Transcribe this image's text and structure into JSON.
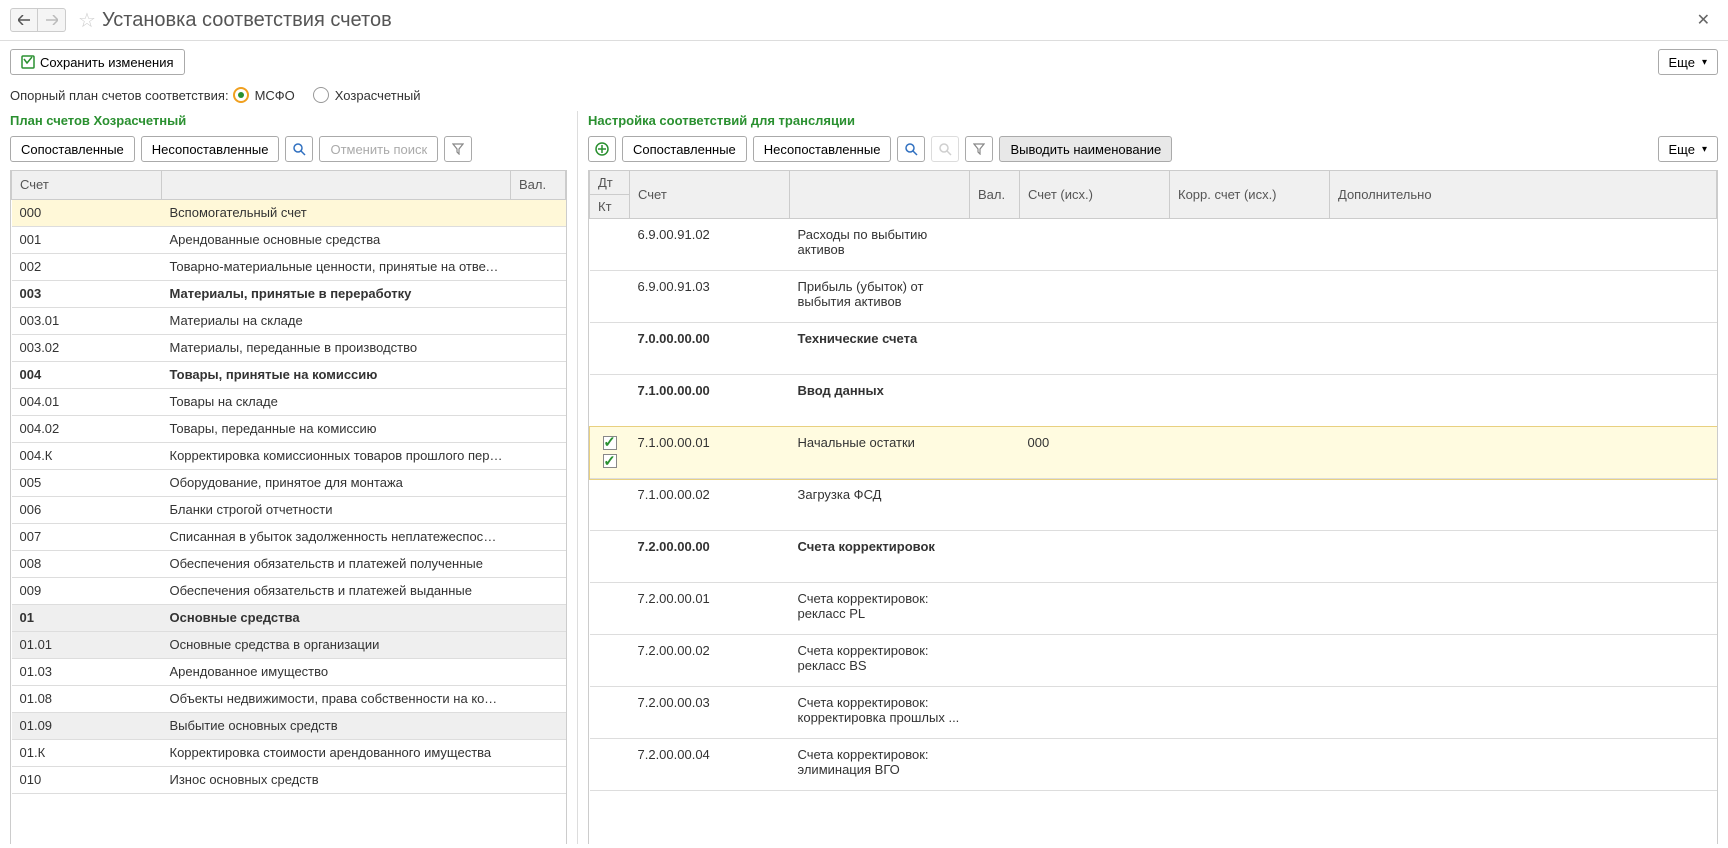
{
  "header": {
    "title": "Установка соответствия счетов"
  },
  "toolbar": {
    "save_label": "Сохранить изменения",
    "more_label": "Еще"
  },
  "radio": {
    "prefix": "Опорный план счетов соответствия:",
    "opt1": "МСФО",
    "opt2": "Хозрасчетный"
  },
  "left": {
    "title": "План счетов Хозрасчетный",
    "btn_matched": "Сопоставленные",
    "btn_unmatched": "Несопоставленные",
    "btn_cancel_search": "Отменить поиск",
    "col_account": "Счет",
    "col_currency": "Вал.",
    "rows": [
      {
        "code": "000",
        "name": "Вспомогательный счет",
        "hl": true
      },
      {
        "code": "001",
        "name": "Арендованные основные средства"
      },
      {
        "code": "002",
        "name": "Товарно-материальные ценности, принятые на ответстве..."
      },
      {
        "code": "003",
        "name": "Материалы, принятые в переработку",
        "bold": true
      },
      {
        "code": "003.01",
        "name": "Материалы на складе"
      },
      {
        "code": "003.02",
        "name": "Материалы, переданные в производство"
      },
      {
        "code": "004",
        "name": "Товары, принятые на комиссию",
        "bold": true
      },
      {
        "code": "004.01",
        "name": "Товары на складе"
      },
      {
        "code": "004.02",
        "name": "Товары, переданные на комиссию"
      },
      {
        "code": "004.К",
        "name": "Корректировка комиссионных товаров прошлого периода"
      },
      {
        "code": "005",
        "name": "Оборудование, принятое для монтажа"
      },
      {
        "code": "006",
        "name": "Бланки строгой отчетности"
      },
      {
        "code": "007",
        "name": "Списанная в убыток задолженность неплатежеспособны..."
      },
      {
        "code": "008",
        "name": "Обеспечения обязательств и платежей полученные"
      },
      {
        "code": "009",
        "name": "Обеспечения обязательств и платежей выданные"
      },
      {
        "code": "01",
        "name": "Основные средства",
        "bold": true,
        "gray": true
      },
      {
        "code": "01.01",
        "name": "Основные средства в организации",
        "gray": true
      },
      {
        "code": "01.03",
        "name": "Арендованное имущество"
      },
      {
        "code": "01.08",
        "name": "Объекты недвижимости, права собственности на которы..."
      },
      {
        "code": "01.09",
        "name": "Выбытие основных средств",
        "gray": true
      },
      {
        "code": "01.К",
        "name": "Корректировка стоимости арендованного имущества"
      },
      {
        "code": "010",
        "name": "Износ основных средств"
      }
    ]
  },
  "right": {
    "title": "Настройка соответствий для трансляции",
    "btn_matched": "Сопоставленные",
    "btn_unmatched": "Несопоставленные",
    "btn_show_name": "Выводить наименование",
    "more_label": "Еще",
    "col_dt": "Дт",
    "col_kt": "Кт",
    "col_account": "Счет",
    "col_currency": "Вал.",
    "col_src": "Счет (исх.)",
    "col_corr": "Корр. счет (исх.)",
    "col_extra": "Дополнительно",
    "rows": [
      {
        "code": "6.9.00.91.02",
        "name": "Расходы по выбытию активов"
      },
      {
        "code": "6.9.00.91.03",
        "name": "Прибыль (убыток) от выбытия активов"
      },
      {
        "code": "7.0.00.00.00",
        "name": "Технические счета",
        "bold": true
      },
      {
        "code": "7.1.00.00.00",
        "name": "Ввод данных",
        "bold": true
      },
      {
        "code": "7.1.00.00.01",
        "name": "Начальные остатки",
        "src": "000",
        "hl": true,
        "chkDt": true,
        "chkKt": true
      },
      {
        "code": "7.1.00.00.02",
        "name": "Загрузка ФСД"
      },
      {
        "code": "7.2.00.00.00",
        "name": "Счета корректировок",
        "bold": true
      },
      {
        "code": "7.2.00.00.01",
        "name": "Счета корректировок: рекласс PL"
      },
      {
        "code": "7.2.00.00.02",
        "name": "Счета корректировок: рекласс BS"
      },
      {
        "code": "7.2.00.00.03",
        "name": "Счета корректировок: корректировка прошлых ..."
      },
      {
        "code": "7.2.00.00.04",
        "name": "Счета корректировок: элиминация ВГО"
      }
    ]
  }
}
